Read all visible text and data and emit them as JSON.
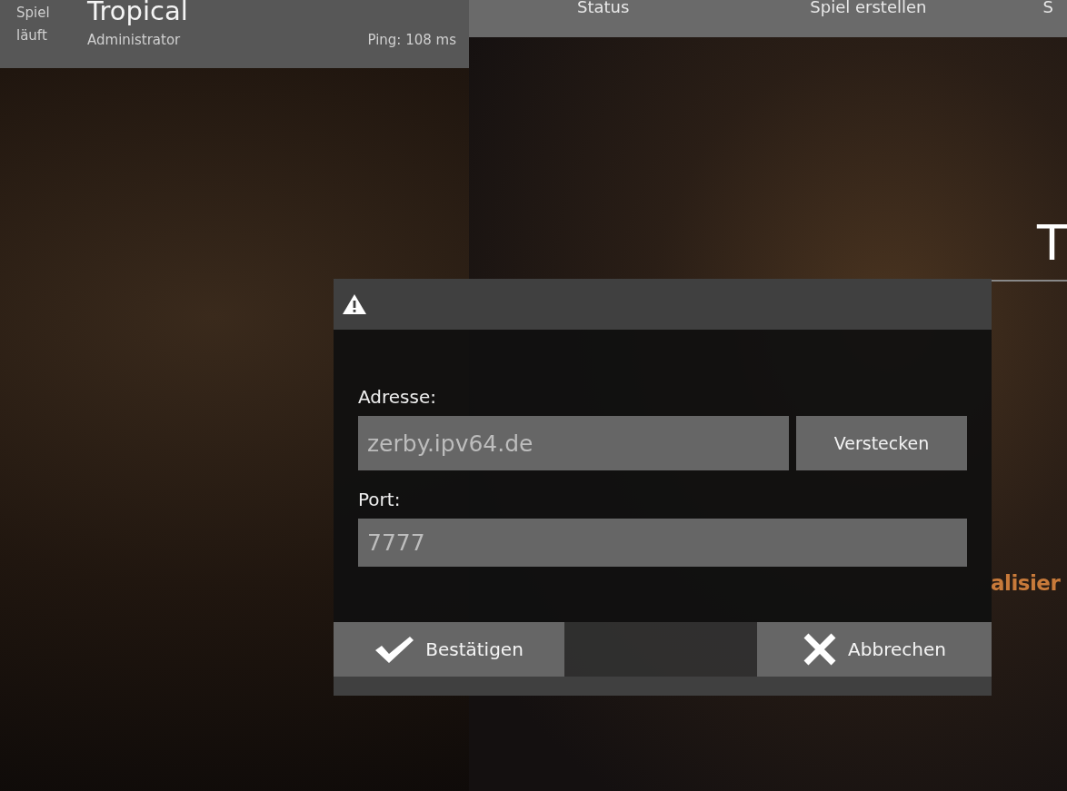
{
  "game_panel": {
    "status": "Spiel läuft",
    "title": "Tropical",
    "role": "Administrator",
    "ping": "Ping: 108 ms"
  },
  "tabs": [
    {
      "label": "Status"
    },
    {
      "label": "Spiel erstellen"
    },
    {
      "label": "S"
    }
  ],
  "server_info": {
    "title": "T",
    "stat_tail": "alisier"
  },
  "dialog": {
    "fields": [
      {
        "label": "Adresse:",
        "value": "zerby.ipv64.de",
        "button": "Verstecken"
      },
      {
        "label": "Port:",
        "value": "7777"
      }
    ],
    "buttons": [
      {
        "kind": "confirm",
        "label": "Bestätigen"
      },
      {
        "kind": "cancel",
        "label": "Abbrechen"
      }
    ]
  }
}
